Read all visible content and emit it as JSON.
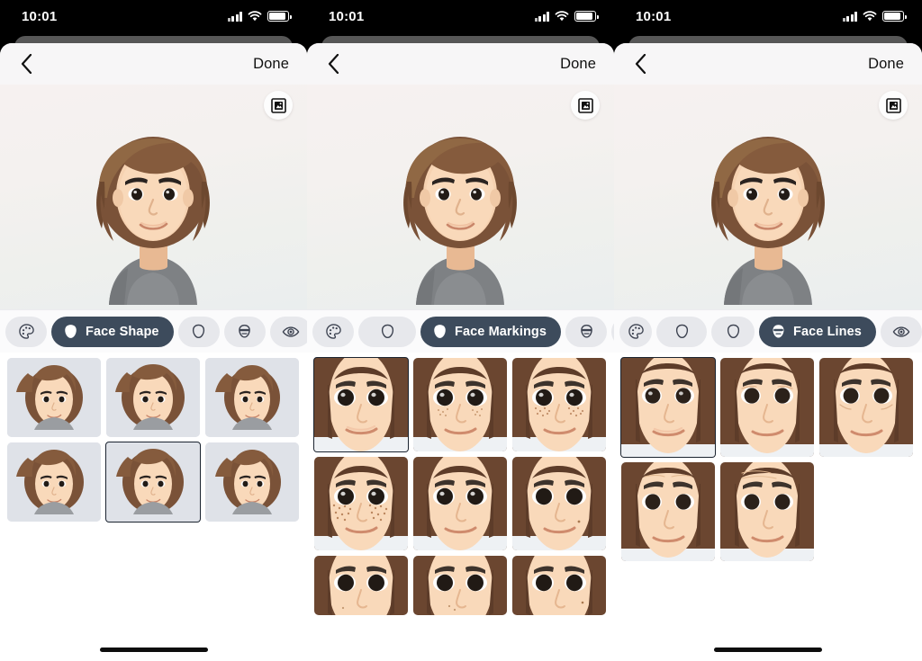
{
  "meta": {
    "app": "Memoji Avatar Editor",
    "panel_count": 3
  },
  "status_bar": {
    "time": "10:01",
    "icons": [
      "cellular-signal-icon",
      "wifi-icon",
      "battery-icon"
    ],
    "battery_level": "full"
  },
  "nav": {
    "back_icon": "chevron-left-icon",
    "done_label": "Done"
  },
  "preview": {
    "frame_button_icon": "picture-frame-icon",
    "avatar_name": "avatar-preview",
    "hair_color": "#7a5238",
    "skin_color": "#f3cdab",
    "shirt_color": "#7e8184",
    "bg_gradient_start": "#f6f1f0",
    "bg_gradient_end": "#eaeeee"
  },
  "theme": {
    "accent_active_tab": "#3d4b5c",
    "tab_inactive_bg": "#e7e8ec",
    "selection_border": "#1b2430",
    "sheet_bg": "#fbfbfc",
    "thumb_bg": "#dfe2e8"
  },
  "panels": [
    {
      "id": "face-shape",
      "tabs": [
        {
          "name": "tab-skin-tone",
          "icon": "palette-icon",
          "label": "",
          "active": false
        },
        {
          "name": "tab-face-shape",
          "icon": "face-shape-icon",
          "label": "Face Shape",
          "active": true
        },
        {
          "name": "tab-face-markings",
          "icon": "face-markings-icon",
          "label": "",
          "active": false
        },
        {
          "name": "tab-face-lines",
          "icon": "face-lines-icon",
          "label": "",
          "active": false
        },
        {
          "name": "tab-eyes",
          "icon": "eye-icon",
          "label": "",
          "active": false
        }
      ],
      "grid": {
        "kind": "face-shape-thumbnails",
        "columns": 3,
        "item_count": 9,
        "selected_index": 7,
        "partial_first_row": true
      },
      "home_indicator": true
    },
    {
      "id": "face-markings",
      "tabs": [
        {
          "name": "tab-skin-tone",
          "icon": "palette-icon",
          "label": "",
          "active": false
        },
        {
          "name": "tab-face-shape",
          "icon": "face-shape-icon",
          "label": "",
          "active": false
        },
        {
          "name": "tab-face-markings",
          "icon": "face-markings-icon",
          "label": "Face Markings",
          "active": true
        },
        {
          "name": "tab-face-lines",
          "icon": "face-lines-icon",
          "label": "",
          "active": false
        },
        {
          "name": "tab-eyes",
          "icon": "eye-icon",
          "label": "",
          "active": false
        }
      ],
      "grid": {
        "kind": "face-markings-thumbnails",
        "columns": 3,
        "item_count": 9,
        "selected_index": 0,
        "partial_first_row": false,
        "freckle_items": [
          1,
          2,
          3
        ]
      },
      "home_indicator": false
    },
    {
      "id": "face-lines",
      "tabs": [
        {
          "name": "tab-skin-tone",
          "icon": "palette-icon",
          "label": "",
          "active": false
        },
        {
          "name": "tab-face-shape",
          "icon": "face-shape-icon",
          "label": "",
          "active": false
        },
        {
          "name": "tab-face-markings",
          "icon": "face-markings-icon",
          "label": "",
          "active": false
        },
        {
          "name": "tab-face-lines",
          "icon": "face-lines-icon",
          "label": "Face Lines",
          "active": true
        },
        {
          "name": "tab-eyes",
          "icon": "eye-icon",
          "label": "",
          "active": false
        }
      ],
      "grid": {
        "kind": "face-lines-thumbnails",
        "columns": 3,
        "item_count": 5,
        "selected_index": 0,
        "partial_first_row": false
      },
      "home_indicator": true
    }
  ]
}
